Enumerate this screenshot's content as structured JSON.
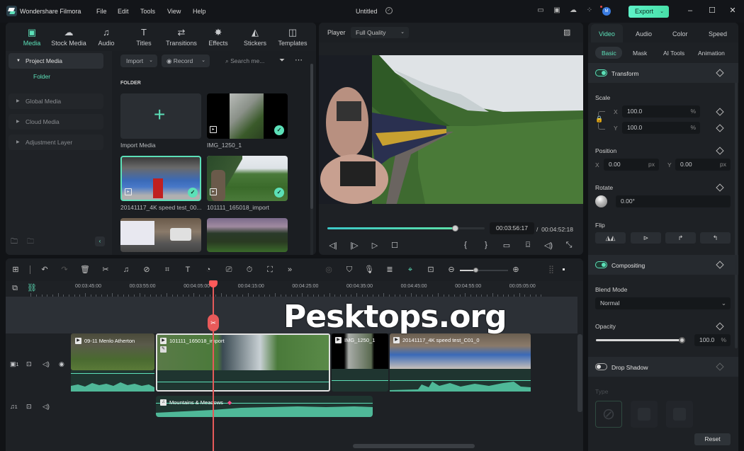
{
  "app": {
    "name": "Wondershare Filmora",
    "menu": [
      "File",
      "Edit",
      "Tools",
      "View",
      "Help"
    ],
    "document_title": "Untitled",
    "avatar_initial": "M",
    "export_label": "Export",
    "title_icons": [
      "layout-icon",
      "save-icon",
      "cloud-upload-icon",
      "apps-icon"
    ]
  },
  "library": {
    "tabs": [
      {
        "label": "Media",
        "icon": "media-icon",
        "glyph": "▣",
        "active": true
      },
      {
        "label": "Stock Media",
        "icon": "stock-media-icon",
        "glyph": "☁",
        "active": false
      },
      {
        "label": "Audio",
        "icon": "audio-icon",
        "glyph": "♫",
        "active": false
      },
      {
        "label": "Titles",
        "icon": "titles-icon",
        "glyph": "T",
        "active": false
      },
      {
        "label": "Transitions",
        "icon": "transitions-icon",
        "glyph": "⇄",
        "active": false
      },
      {
        "label": "Effects",
        "icon": "effects-icon",
        "glyph": "✸",
        "active": false
      },
      {
        "label": "Stickers",
        "icon": "stickers-icon",
        "glyph": "◭",
        "active": false
      },
      {
        "label": "Templates",
        "icon": "templates-icon",
        "glyph": "◫",
        "active": false
      }
    ],
    "sidebar": {
      "project_media": "Project Media",
      "folder": "Folder",
      "items": [
        "Global Media",
        "Cloud Media",
        "Adjustment Layer"
      ]
    },
    "toolbar": {
      "import": "Import",
      "record": "Record",
      "search_placeholder": "Search me..."
    },
    "folder_header": "FOLDER",
    "media": [
      {
        "name": "Import Media",
        "type": "import"
      },
      {
        "name": "IMG_1250_1",
        "checked": true
      },
      {
        "name": "20141117_4K speed test_00...",
        "checked": true,
        "selected": true
      },
      {
        "name": "101111_165018_import",
        "checked": true
      },
      {
        "name": "",
        "checked": true
      },
      {
        "name": "",
        "checked": true
      }
    ]
  },
  "player": {
    "label": "Player",
    "quality": "Full Quality",
    "current_time": "00:03:56:17",
    "separator": "/",
    "total_time": "00:04:52:18",
    "progress_fraction": 0.81
  },
  "properties": {
    "tabs": [
      "Video",
      "Audio",
      "Color",
      "Speed"
    ],
    "active_tab": "Video",
    "subtabs": [
      "Basic",
      "Mask",
      "AI Tools",
      "Animation"
    ],
    "active_subtab": "Basic",
    "transform": {
      "label": "Transform",
      "enabled": true,
      "scale_label": "Scale",
      "scale_x": "100.0",
      "scale_y": "100.0",
      "scale_unit": "%",
      "position_label": "Position",
      "pos_x": "0.00",
      "pos_y": "0.00",
      "pos_unit": "px",
      "rotate_label": "Rotate",
      "rotate": "0.00°",
      "flip_label": "Flip"
    },
    "compositing": {
      "label": "Compositing",
      "enabled": true,
      "blend_label": "Blend Mode",
      "blend_mode": "Normal",
      "opacity_label": "Opacity",
      "opacity": "100.0",
      "opacity_unit": "%",
      "opacity_fraction": 1.0
    },
    "drop_shadow": {
      "label": "Drop Shadow",
      "enabled": false,
      "type_label": "Type"
    },
    "reset_label": "Reset",
    "axis_x": "X",
    "axis_y": "Y"
  },
  "timeline": {
    "ruler": [
      "00:03:45:00",
      "00:03:55:00",
      "00:04:05:00",
      "00:04:15:00",
      "00:04:25:00",
      "00:04:35:00",
      "00:04:45:00",
      "00:04:55:00",
      "00:05:05:00"
    ],
    "video_track_num": "1",
    "audio_track_num": "1",
    "zoom_fraction": 0.33,
    "clips": [
      {
        "name": "09-11 Menlo Atherton"
      },
      {
        "name": "101111_165018_import",
        "selected": true
      },
      {
        "name": "IMG_1250_1"
      },
      {
        "name": "20141117_4K speed test_C01_0"
      }
    ],
    "audio_clip": {
      "name": "Mountains & Meadows"
    }
  },
  "watermark": "Pesktops.org"
}
